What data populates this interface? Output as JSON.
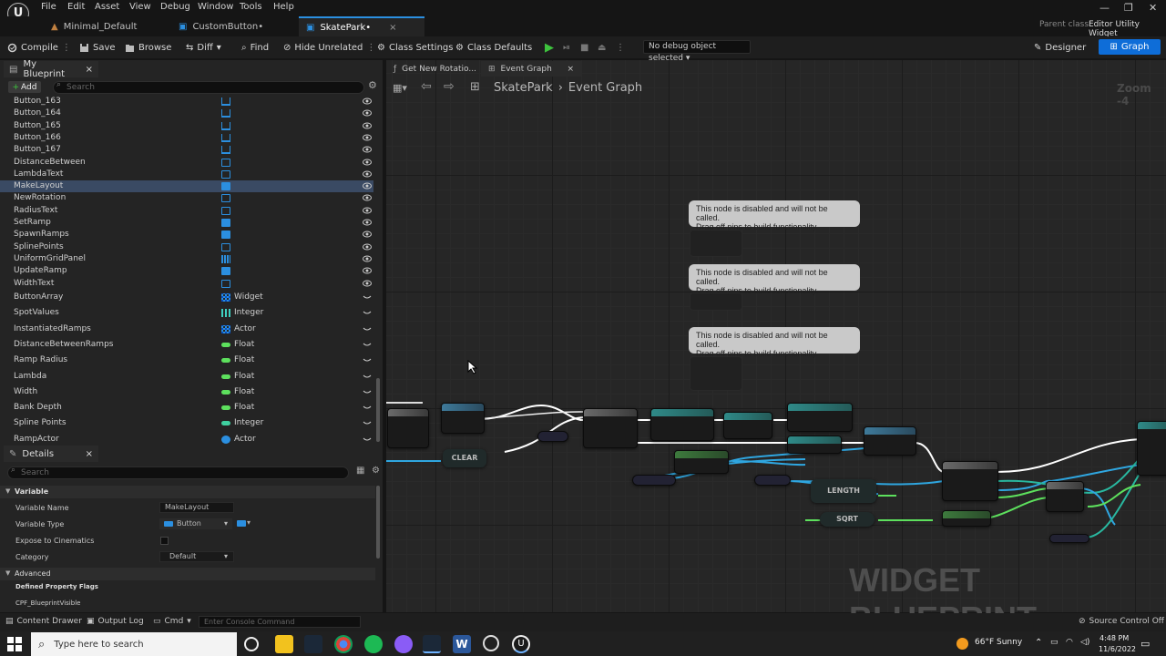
{
  "menu": [
    "File",
    "Edit",
    "Asset",
    "View",
    "Debug",
    "Window",
    "Tools",
    "Help"
  ],
  "parent_class": {
    "label": "Parent class:",
    "value": "Editor Utility Widget"
  },
  "doc_tabs": [
    {
      "label": "Minimal_Default"
    },
    {
      "label": "CustomButton•"
    },
    {
      "label": "SkatePark•",
      "close": "×"
    }
  ],
  "toolbar": {
    "compile": "Compile",
    "save": "Save",
    "browse": "Browse",
    "diff": "Diff",
    "find": "Find",
    "hide_unrelated": "Hide Unrelated",
    "class_settings": "Class Settings",
    "class_defaults": "Class Defaults",
    "debug_object": "No debug object selected",
    "designer": "Designer",
    "graph": "Graph"
  },
  "my_blueprint": {
    "tab": "My Blueprint",
    "close": "×",
    "add": "Add",
    "search_placeholder": "Search",
    "variables": [
      {
        "name": "Button_163",
        "type": "",
        "icon": "button-blue"
      },
      {
        "name": "Button_164",
        "type": "",
        "icon": "button-blue"
      },
      {
        "name": "Button_165",
        "type": "",
        "icon": "button-blue"
      },
      {
        "name": "Button_166",
        "type": "",
        "icon": "button-blue"
      },
      {
        "name": "Button_167",
        "type": "",
        "icon": "button-blue"
      },
      {
        "name": "DistanceBetween",
        "type": "",
        "icon": "text-outline"
      },
      {
        "name": "LambdaText",
        "type": "",
        "icon": "text-outline"
      },
      {
        "name": "MakeLayout",
        "type": "",
        "icon": "button-solid",
        "selected": true
      },
      {
        "name": "NewRotation",
        "type": "",
        "icon": "text-outline"
      },
      {
        "name": "RadiusText",
        "type": "",
        "icon": "text-outline"
      },
      {
        "name": "SetRamp",
        "type": "",
        "icon": "button-solid"
      },
      {
        "name": "SpawnRamps",
        "type": "",
        "icon": "button-solid"
      },
      {
        "name": "SplinePoints",
        "type": "",
        "icon": "text-outline"
      },
      {
        "name": "UniformGridPanel",
        "type": "",
        "icon": "grid"
      },
      {
        "name": "UpdateRamp",
        "type": "",
        "icon": "button-solid"
      },
      {
        "name": "WidthText",
        "type": "",
        "icon": "text-outline"
      },
      {
        "name": "ButtonArray",
        "type": "Widget",
        "icon": "array-blue"
      },
      {
        "name": "SpotValues",
        "type": "Integer",
        "icon": "array-teal"
      },
      {
        "name": "InstantiatedRamps",
        "type": "Actor",
        "icon": "array-blue"
      },
      {
        "name": "DistanceBetweenRamps",
        "type": "Float",
        "icon": "float"
      },
      {
        "name": "Ramp Radius",
        "type": "Float",
        "icon": "float"
      },
      {
        "name": "Lambda",
        "type": "Float",
        "icon": "float"
      },
      {
        "name": "Width",
        "type": "Float",
        "icon": "float"
      },
      {
        "name": "Bank Depth",
        "type": "Float",
        "icon": "float"
      },
      {
        "name": "Spline Points",
        "type": "Integer",
        "icon": "integer"
      },
      {
        "name": "RampActor",
        "type": "Actor",
        "icon": "actor"
      }
    ]
  },
  "details": {
    "tab": "Details",
    "close": "×",
    "search_placeholder": "Search",
    "section_variable": "Variable",
    "variable_name_label": "Variable Name",
    "variable_name_value": "MakeLayout",
    "variable_type_label": "Variable Type",
    "variable_type_value": "Button",
    "expose_label": "Expose to Cinematics",
    "category_label": "Category",
    "category_value": "Default",
    "section_advanced": "Advanced",
    "flags_label": "Defined Property Flags",
    "flag_1": "CPF_BlueprintVisible"
  },
  "graph": {
    "tabs": [
      {
        "label": "Get New Rotatio..."
      },
      {
        "label": "Event Graph",
        "close": "×"
      }
    ],
    "breadcrumb_root": "SkatePark",
    "breadcrumb_sep": "›",
    "breadcrumb_leaf": "Event Graph",
    "zoom": "Zoom -4",
    "watermark": "WIDGET BLUEPRINT",
    "disabled_notes": [
      {
        "line1": "This node is disabled and will not be called.",
        "line2": "Drag off pins to build functionality."
      },
      {
        "line1": "This node is disabled and will not be called.",
        "line2": "Drag off pins to build functionality."
      },
      {
        "line1": "This node is disabled and will not be called.",
        "line2": "Drag off pins to build functionality."
      }
    ],
    "pure_nodes": {
      "clear": "CLEAR",
      "length": "LENGTH",
      "sqrt": "SQRT"
    }
  },
  "bottombar": {
    "content_drawer": "Content Drawer",
    "output_log": "Output Log",
    "cmd": "Cmd",
    "console_placeholder": "Enter Console Command",
    "source_control": "Source Control Off"
  },
  "taskbar": {
    "search_placeholder": "Type here to search",
    "weather": "66°F  Sunny",
    "time": "4:48 PM",
    "date": "11/6/2022"
  },
  "colors": {
    "accent": "#0e6dd8",
    "selection": "#3a4a63",
    "exec": "#ffffff",
    "float_pin": "#5de05d",
    "object_pin": "#2fa6e0"
  }
}
